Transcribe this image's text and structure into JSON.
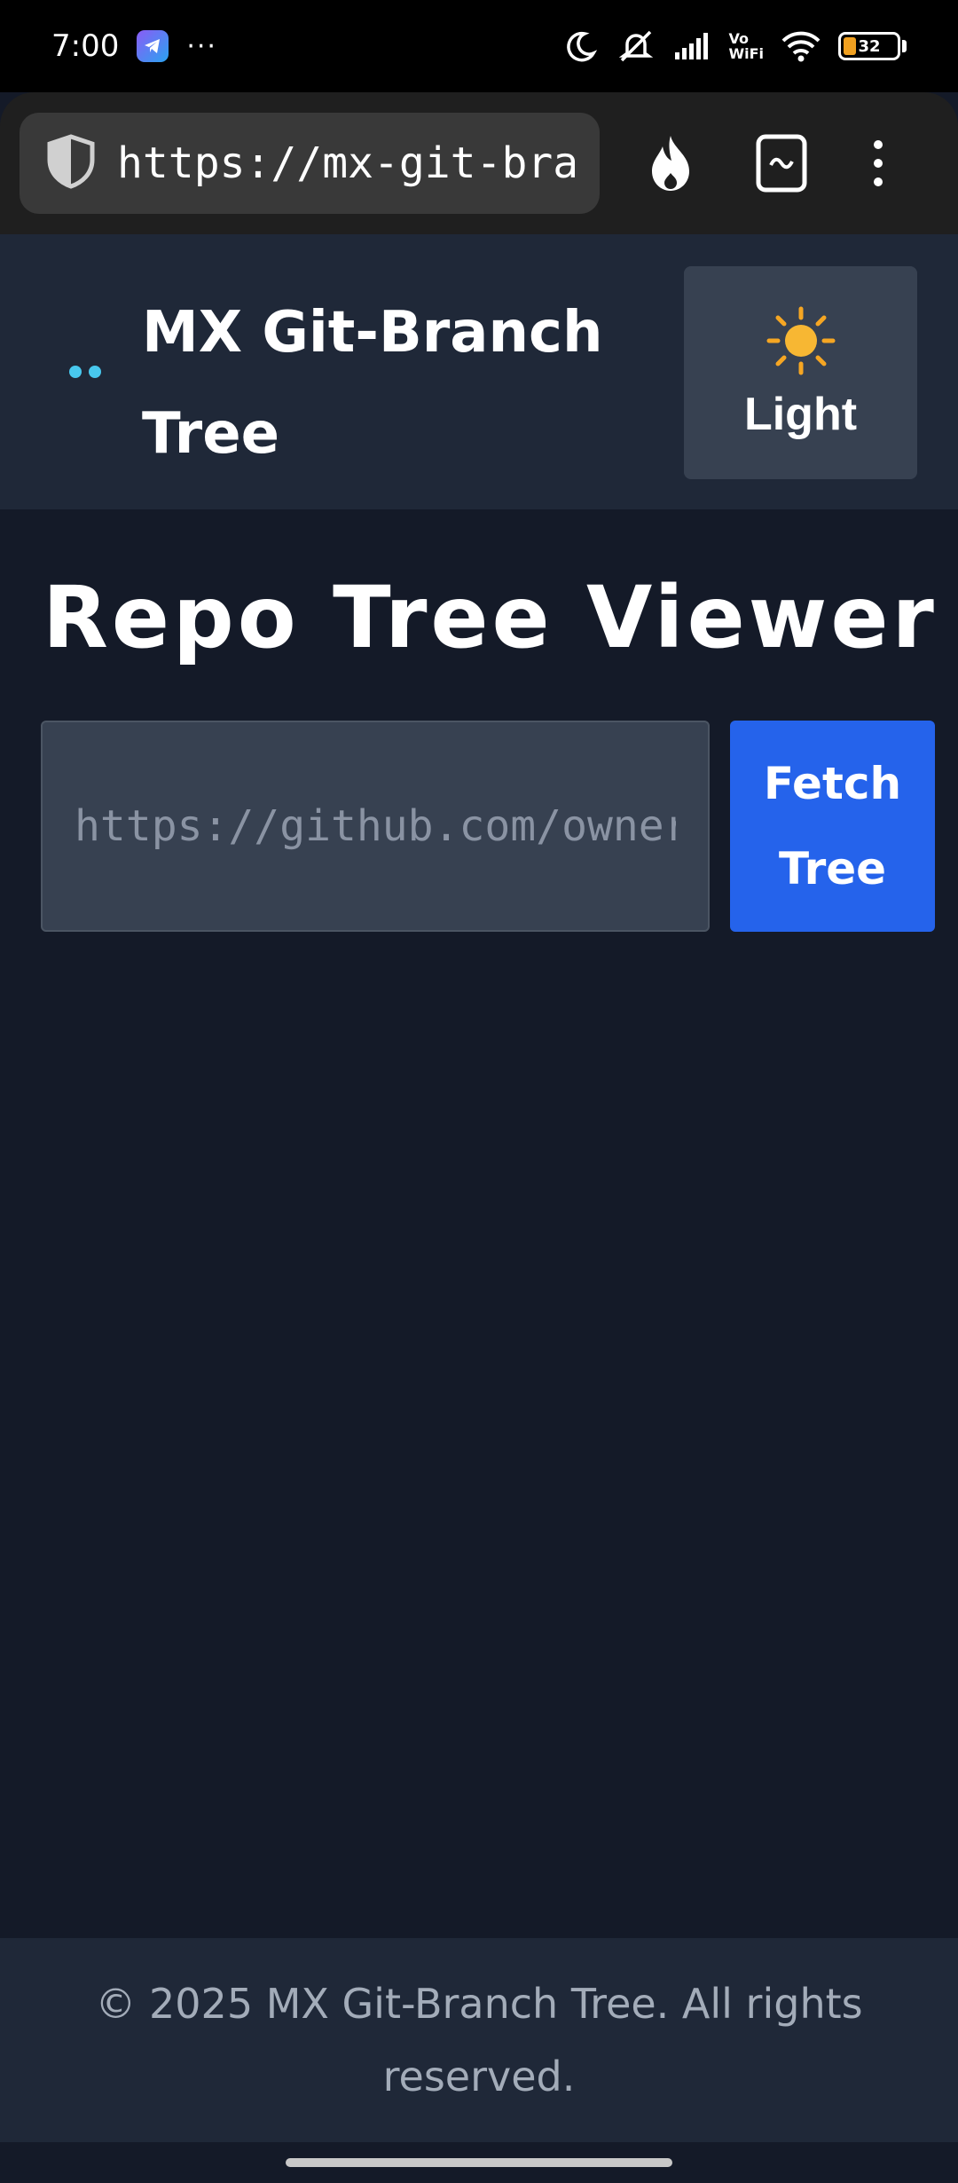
{
  "status_bar": {
    "time": "7:00",
    "more": "···",
    "battery": "32",
    "icons": [
      "telegram-icon",
      "moon-icon",
      "mute-icon",
      "signal-icon",
      "vowifi-icon",
      "wifi-icon",
      "battery-icon"
    ],
    "vowifi_line1": "Vo",
    "vowifi_line2": "WiFi"
  },
  "browser": {
    "url": "https://mx-git-branch-tree",
    "icons": [
      "shield-icon",
      "flame-icon",
      "tab-switcher-icon",
      "more-vertical-icon"
    ]
  },
  "header": {
    "title": "MX Git-Branch Tree",
    "theme_toggle": {
      "emoji": "☀️",
      "label": "Light"
    }
  },
  "main": {
    "heading": "Repo Tree Viewer",
    "repo_input": {
      "value": "",
      "placeholder": "https://github.com/owner/repo"
    },
    "fetch_button": "Fetch Tree"
  },
  "footer": {
    "text": "© 2025 MX Git-Branch Tree. All rights reserved."
  },
  "colors": {
    "background": "#141a28",
    "header_bg": "#1f2838",
    "button_primary": "#2563eb",
    "input_bg": "#374151",
    "logo_accent": "#48c8ee"
  }
}
